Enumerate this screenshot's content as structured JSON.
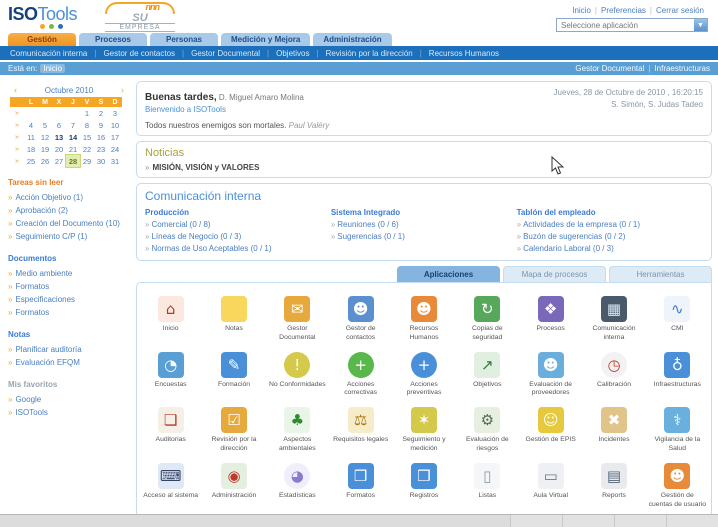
{
  "header": {
    "logo_iso": "ISO",
    "logo_tools": "Tools",
    "logo_dot_colors": [
      "#f5a623",
      "#7ab648",
      "#2a6fbb"
    ],
    "company_logo": {
      "top": "SU",
      "bottom": "EMPRESA",
      "arc_glyph": "nnn"
    },
    "links": [
      "Inicio",
      "Preferencias",
      "Cerrar sesión"
    ],
    "app_select_value": "Seleccione aplicación"
  },
  "nav": {
    "tabs": [
      {
        "label": "Gestión",
        "active": true
      },
      {
        "label": "Procesos",
        "active": false
      },
      {
        "label": "Personas",
        "active": false
      },
      {
        "label": "Medición y Mejora",
        "active": false
      },
      {
        "label": "Administración",
        "active": false
      }
    ],
    "subnav": [
      "Comunicación interna",
      "Gestor de contactos",
      "Gestor Documental",
      "Objetivos",
      "Revisión por la dirección",
      "Recursos Humanos"
    ]
  },
  "breadcrumb": {
    "prefix": "Está en:",
    "current": "Inicio",
    "right_links": [
      "Gestor Documental",
      "Infraestructuras"
    ]
  },
  "calendar": {
    "title": "Octubre 2010",
    "prev": "‹",
    "next": "›",
    "day_headers": [
      "L",
      "M",
      "X",
      "J",
      "V",
      "S",
      "D"
    ],
    "week_marker": "»",
    "weeks": [
      [
        "",
        "",
        "",
        "",
        "1",
        "2",
        "3"
      ],
      [
        "4",
        "5",
        "6",
        "7",
        "8",
        "9",
        "10"
      ],
      [
        "11",
        "12",
        "13",
        "14",
        "15",
        "16",
        "17"
      ],
      [
        "18",
        "19",
        "20",
        "21",
        "22",
        "23",
        "24"
      ],
      [
        "25",
        "26",
        "27",
        "28",
        "29",
        "30",
        "31"
      ]
    ],
    "today": "28",
    "bold_days": [
      "13",
      "14"
    ]
  },
  "sidebar_sections": [
    {
      "title": "Tareas sin leer",
      "title_color": "#e67e22",
      "items": [
        "Acción Objetivo (1)",
        "Aprobación (2)",
        "Creación del Documento (10)",
        "Seguimiento C/P (1)"
      ]
    },
    {
      "title": "Documentos",
      "title_color": "#3a7bd5",
      "items": [
        "Medio ambiente",
        "Formatos",
        "Especificaciones",
        "Formatos"
      ]
    },
    {
      "title": "Notas",
      "title_color": "#3a7bd5",
      "items": [
        "Planificar auditoría",
        "Evaluación EFQM"
      ]
    },
    {
      "title": "Mis favoritos",
      "title_color": "#9aa5b0",
      "items": [
        "Google",
        "ISOTools"
      ]
    }
  ],
  "greeting": {
    "salutation": "Buenas tardes,",
    "user": " D. Miguel Amaro Molina",
    "welcome": "Bienvenido a ISOTools",
    "quote": "Todos nuestros enemigos son mortales.",
    "quote_author": " Paul Valéry",
    "datetime": "Jueves, 28 de Octubre de 2010 , 16:20:15",
    "saints": "S. Simón, S. Judas Tadeo"
  },
  "noticias": {
    "title": "Noticias",
    "marker": "»",
    "items": [
      "MISIÓN, VISIÓN y VALORES"
    ]
  },
  "comunicacion": {
    "title": "Comunicación interna",
    "marker": "»",
    "columns": [
      {
        "title": "Producción",
        "items": [
          "Comercial (0 / 8)",
          "Líneas de Negocio (0 / 3)",
          "Normas de Uso Aceptables (0 / 1)"
        ]
      },
      {
        "title": "Sistema Integrado",
        "items": [
          "Reuniones (0 / 6)",
          "Sugerencias (0 / 1)"
        ]
      },
      {
        "title": "Tablón del empleado",
        "items": [
          "Actividades de la empresa (0 / 1)",
          "Buzón de sugerencias (0 / 2)",
          "Calendario Laboral (0 / 3)"
        ]
      }
    ]
  },
  "content_tabs": [
    {
      "label": "Aplicaciones",
      "active": true
    },
    {
      "label": "Mapa de procesos",
      "active": false
    },
    {
      "label": "Herramientas",
      "active": false
    }
  ],
  "apps": [
    {
      "label": "Inicio",
      "icon": "home-icon",
      "glyph": "⌂",
      "fg": "#b23b2a",
      "bg": "#fbe9df",
      "round": false
    },
    {
      "label": "Notas",
      "icon": "sticky-note-icon",
      "glyph": "",
      "fg": "#c9a82a",
      "bg": "#f9d65c",
      "round": false
    },
    {
      "label": "Gestor Documental",
      "icon": "folder-mail-icon",
      "glyph": "✉",
      "fg": "#ffffff",
      "bg": "#e6a93c",
      "round": false
    },
    {
      "label": "Gestor de contactos",
      "icon": "contacts-icon",
      "glyph": "☻",
      "fg": "#ffffff",
      "bg": "#5a8fd0",
      "round": false
    },
    {
      "label": "Recursos Humanos",
      "icon": "people-group-icon",
      "glyph": "☻",
      "fg": "#ffffff",
      "bg": "#e78b3a",
      "round": false
    },
    {
      "label": "Copias de seguridad",
      "icon": "backup-icon",
      "glyph": "↻",
      "fg": "#ffffff",
      "bg": "#58a85c",
      "round": false
    },
    {
      "label": "Procesos",
      "icon": "process-shapes-icon",
      "glyph": "❖",
      "fg": "#ffffff",
      "bg": "#7a68b8",
      "round": false
    },
    {
      "label": "Comunicación interna",
      "icon": "board-people-icon",
      "glyph": "▦",
      "fg": "#d8e6f2",
      "bg": "#4a5a6a",
      "round": false
    },
    {
      "label": "CMI",
      "icon": "line-chart-icon",
      "glyph": "∿",
      "fg": "#3a7bd5",
      "bg": "#eef4f9",
      "round": false
    },
    {
      "label": "Encuestas",
      "icon": "survey-monitor-icon",
      "glyph": "◔",
      "fg": "#ffffff",
      "bg": "#5a9fd4",
      "round": false
    },
    {
      "label": "Formación",
      "icon": "pencil-icon",
      "glyph": "✎",
      "fg": "#ffffff",
      "bg": "#4a90d9",
      "round": false
    },
    {
      "label": "No Conformidades",
      "icon": "warning-circle-icon",
      "glyph": "!",
      "fg": "#ffffff",
      "bg": "#d4c94a",
      "round": true
    },
    {
      "label": "Acciones correctivas",
      "icon": "plus-green-icon",
      "glyph": "+",
      "fg": "#ffffff",
      "bg": "#58b84a",
      "round": true
    },
    {
      "label": "Acciones preventivas",
      "icon": "plus-blue-icon",
      "glyph": "+",
      "fg": "#ffffff",
      "bg": "#4a90d9",
      "round": true
    },
    {
      "label": "Objetivos",
      "icon": "chart-up-icon",
      "glyph": "↗",
      "fg": "#2e7d32",
      "bg": "#e0efe0",
      "round": false
    },
    {
      "label": "Evaluación de proveedores",
      "icon": "supplier-search-icon",
      "glyph": "☻",
      "fg": "#ffffff",
      "bg": "#6aaede",
      "round": false
    },
    {
      "label": "Calibración",
      "icon": "gauge-icon",
      "glyph": "◷",
      "fg": "#c0392b",
      "bg": "#f2f2f2",
      "round": true
    },
    {
      "label": "Infraestructuras",
      "icon": "globe-server-icon",
      "glyph": "♁",
      "fg": "#ffffff",
      "bg": "#4a90d9",
      "round": false
    },
    {
      "label": "Auditorias",
      "icon": "document-seal-icon",
      "glyph": "❏",
      "fg": "#b23b2a",
      "bg": "#f6efe8",
      "round": false
    },
    {
      "label": "Revisión por la dirección",
      "icon": "review-doc-icon",
      "glyph": "☑",
      "fg": "#ffffff",
      "bg": "#e6a93c",
      "round": false
    },
    {
      "label": "Aspectos ambientales",
      "icon": "tree-icon",
      "glyph": "♣",
      "fg": "#2e8b2e",
      "bg": "#eaf5ea",
      "round": false
    },
    {
      "label": "Requisitos legales",
      "icon": "gavel-icon",
      "glyph": "⚖",
      "fg": "#a8760a",
      "bg": "#f7ecca",
      "round": false
    },
    {
      "label": "Seguimiento y medición",
      "icon": "bulb-icon",
      "glyph": "✶",
      "fg": "#ffffff",
      "bg": "#d4c94a",
      "round": false
    },
    {
      "label": "Evaluación de riesgos",
      "icon": "risk-gears-icon",
      "glyph": "⚙",
      "fg": "#5a6a5a",
      "bg": "#e6efe0",
      "round": false
    },
    {
      "label": "Gestión de EPIS",
      "icon": "worker-icon",
      "glyph": "☺",
      "fg": "#ffffff",
      "bg": "#e6c93c",
      "round": false
    },
    {
      "label": "Incidentes",
      "icon": "bandage-cross-icon",
      "glyph": "✖",
      "fg": "#ffffff",
      "bg": "#e0c48a",
      "round": false
    },
    {
      "label": "Vigilancia de la Salud",
      "icon": "medical-icon",
      "glyph": "⚕",
      "fg": "#ffffff",
      "bg": "#6ab0de",
      "round": false
    },
    {
      "label": "Acceso al sistema",
      "icon": "system-access-icon",
      "glyph": "⌨",
      "fg": "#334466",
      "bg": "#dfe8f5",
      "round": false
    },
    {
      "label": "Administración",
      "icon": "admin-globe-icon",
      "glyph": "◉",
      "fg": "#c0392b",
      "bg": "#e4efe0",
      "round": false
    },
    {
      "label": "Estadísticas",
      "icon": "pie-chart-icon",
      "glyph": "◕",
      "fg": "#8a7ad0",
      "bg": "#efeefa",
      "round": true
    },
    {
      "label": "Formatos",
      "icon": "archive-box-icon",
      "glyph": "❒",
      "fg": "#ffffff",
      "bg": "#4a90d9",
      "round": false
    },
    {
      "label": "Registros",
      "icon": "archive-box-icon",
      "glyph": "❒",
      "fg": "#ffffff",
      "bg": "#4a90d9",
      "round": false
    },
    {
      "label": "Listas",
      "icon": "list-paper-icon",
      "glyph": "▯",
      "fg": "#8899aa",
      "bg": "#f4f6f8",
      "round": false
    },
    {
      "label": "Aula Virtual",
      "icon": "projector-icon",
      "glyph": "▭",
      "fg": "#667788",
      "bg": "#eef0f4",
      "round": false
    },
    {
      "label": "Reports",
      "icon": "printer-icon",
      "glyph": "▤",
      "fg": "#556677",
      "bg": "#e8eaee",
      "round": false
    },
    {
      "label": "Gestión de cuentas de usuario",
      "icon": "user-accounts-icon",
      "glyph": "☻",
      "fg": "#ffffff",
      "bg": "#e78b3a",
      "round": false
    }
  ]
}
